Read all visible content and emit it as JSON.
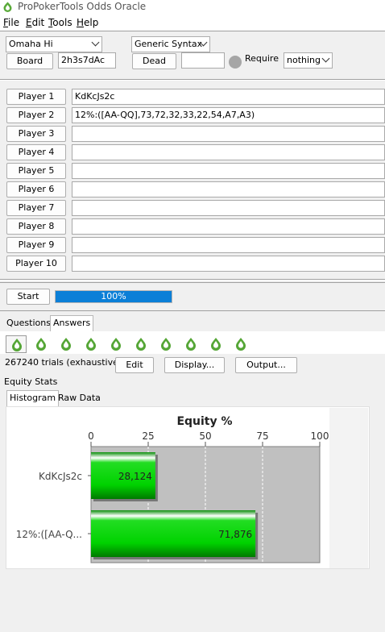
{
  "window": {
    "title": "ProPokerTools Odds Oracle"
  },
  "menu": [
    {
      "label": "File",
      "mnemonic": "F",
      "rest": "ile"
    },
    {
      "label": "Edit",
      "mnemonic": "E",
      "rest": "dit"
    },
    {
      "label": "Tools",
      "mnemonic": "T",
      "rest": "ools"
    },
    {
      "label": "Help",
      "mnemonic": "H",
      "rest": "elp"
    }
  ],
  "setup": {
    "game": "Omaha Hi",
    "syntax": "Generic Syntax",
    "board_button": "Board",
    "board_value": "2h3s7dAc",
    "dead_button": "Dead",
    "dead_value": "",
    "require_label": "Require",
    "require_value": "nothing"
  },
  "players": [
    {
      "label": "Player 1",
      "hand": "KdKcJs2c"
    },
    {
      "label": "Player 2",
      "hand": "12%:([AA-QQ],73,72,32,33,22,54,A7,A3)"
    },
    {
      "label": "Player 3",
      "hand": ""
    },
    {
      "label": "Player 4",
      "hand": ""
    },
    {
      "label": "Player 5",
      "hand": ""
    },
    {
      "label": "Player 6",
      "hand": ""
    },
    {
      "label": "Player 7",
      "hand": ""
    },
    {
      "label": "Player 8",
      "hand": ""
    },
    {
      "label": "Player 9",
      "hand": ""
    },
    {
      "label": "Player 10",
      "hand": ""
    }
  ],
  "run": {
    "start_button": "Start",
    "progress_text": "100%",
    "progress": 1.0
  },
  "tabs": {
    "questions": "Questions",
    "answers": "Answers"
  },
  "results": {
    "trials": "267240 trials (exhaustive)",
    "edit_button": "Edit",
    "display_button": "Display...",
    "output_button": "Output...",
    "section_label": "Equity Stats",
    "subtabs": {
      "histogram": "Histogram",
      "raw": "Raw Data"
    }
  },
  "colors": {
    "accent": "#0b7fd7",
    "bar": "#00cc00",
    "plot_bg": "#c0c0c0"
  },
  "chart_data": {
    "type": "bar",
    "orientation": "horizontal",
    "title": "Equity %",
    "categories": [
      "KdKcJs2c",
      "12%:([AA-Q..."
    ],
    "values": [
      28.124,
      71.876
    ],
    "value_labels": [
      "28,124",
      "71,876"
    ],
    "xlim": [
      0,
      100
    ],
    "ticks": [
      0,
      25,
      50,
      75,
      100
    ],
    "grid": true
  }
}
